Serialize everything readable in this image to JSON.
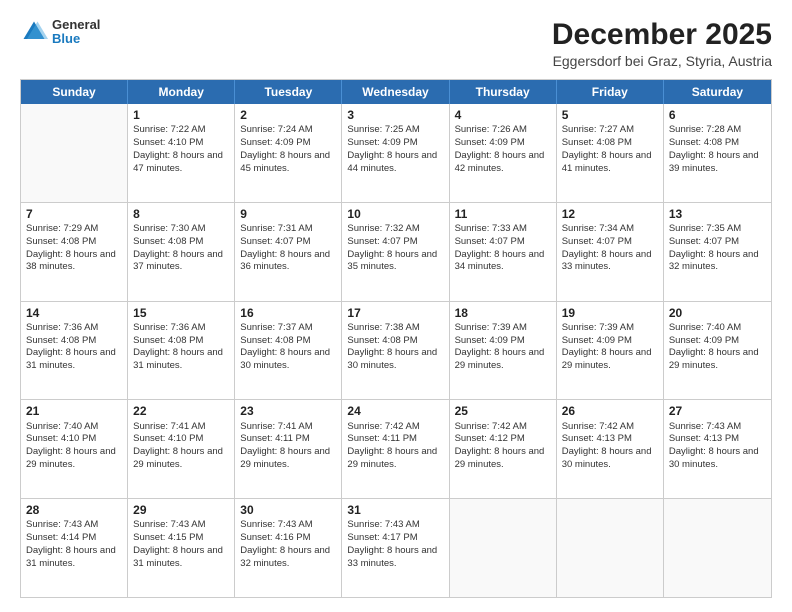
{
  "logo": {
    "general": "General",
    "blue": "Blue"
  },
  "header": {
    "title": "December 2025",
    "subtitle": "Eggersdorf bei Graz, Styria, Austria"
  },
  "weekdays": [
    "Sunday",
    "Monday",
    "Tuesday",
    "Wednesday",
    "Thursday",
    "Friday",
    "Saturday"
  ],
  "weeks": [
    [
      {
        "day": "",
        "sunrise": "",
        "sunset": "",
        "daylight": ""
      },
      {
        "day": "1",
        "sunrise": "Sunrise: 7:22 AM",
        "sunset": "Sunset: 4:10 PM",
        "daylight": "Daylight: 8 hours and 47 minutes."
      },
      {
        "day": "2",
        "sunrise": "Sunrise: 7:24 AM",
        "sunset": "Sunset: 4:09 PM",
        "daylight": "Daylight: 8 hours and 45 minutes."
      },
      {
        "day": "3",
        "sunrise": "Sunrise: 7:25 AM",
        "sunset": "Sunset: 4:09 PM",
        "daylight": "Daylight: 8 hours and 44 minutes."
      },
      {
        "day": "4",
        "sunrise": "Sunrise: 7:26 AM",
        "sunset": "Sunset: 4:09 PM",
        "daylight": "Daylight: 8 hours and 42 minutes."
      },
      {
        "day": "5",
        "sunrise": "Sunrise: 7:27 AM",
        "sunset": "Sunset: 4:08 PM",
        "daylight": "Daylight: 8 hours and 41 minutes."
      },
      {
        "day": "6",
        "sunrise": "Sunrise: 7:28 AM",
        "sunset": "Sunset: 4:08 PM",
        "daylight": "Daylight: 8 hours and 39 minutes."
      }
    ],
    [
      {
        "day": "7",
        "sunrise": "Sunrise: 7:29 AM",
        "sunset": "Sunset: 4:08 PM",
        "daylight": "Daylight: 8 hours and 38 minutes."
      },
      {
        "day": "8",
        "sunrise": "Sunrise: 7:30 AM",
        "sunset": "Sunset: 4:08 PM",
        "daylight": "Daylight: 8 hours and 37 minutes."
      },
      {
        "day": "9",
        "sunrise": "Sunrise: 7:31 AM",
        "sunset": "Sunset: 4:07 PM",
        "daylight": "Daylight: 8 hours and 36 minutes."
      },
      {
        "day": "10",
        "sunrise": "Sunrise: 7:32 AM",
        "sunset": "Sunset: 4:07 PM",
        "daylight": "Daylight: 8 hours and 35 minutes."
      },
      {
        "day": "11",
        "sunrise": "Sunrise: 7:33 AM",
        "sunset": "Sunset: 4:07 PM",
        "daylight": "Daylight: 8 hours and 34 minutes."
      },
      {
        "day": "12",
        "sunrise": "Sunrise: 7:34 AM",
        "sunset": "Sunset: 4:07 PM",
        "daylight": "Daylight: 8 hours and 33 minutes."
      },
      {
        "day": "13",
        "sunrise": "Sunrise: 7:35 AM",
        "sunset": "Sunset: 4:07 PM",
        "daylight": "Daylight: 8 hours and 32 minutes."
      }
    ],
    [
      {
        "day": "14",
        "sunrise": "Sunrise: 7:36 AM",
        "sunset": "Sunset: 4:08 PM",
        "daylight": "Daylight: 8 hours and 31 minutes."
      },
      {
        "day": "15",
        "sunrise": "Sunrise: 7:36 AM",
        "sunset": "Sunset: 4:08 PM",
        "daylight": "Daylight: 8 hours and 31 minutes."
      },
      {
        "day": "16",
        "sunrise": "Sunrise: 7:37 AM",
        "sunset": "Sunset: 4:08 PM",
        "daylight": "Daylight: 8 hours and 30 minutes."
      },
      {
        "day": "17",
        "sunrise": "Sunrise: 7:38 AM",
        "sunset": "Sunset: 4:08 PM",
        "daylight": "Daylight: 8 hours and 30 minutes."
      },
      {
        "day": "18",
        "sunrise": "Sunrise: 7:39 AM",
        "sunset": "Sunset: 4:09 PM",
        "daylight": "Daylight: 8 hours and 29 minutes."
      },
      {
        "day": "19",
        "sunrise": "Sunrise: 7:39 AM",
        "sunset": "Sunset: 4:09 PM",
        "daylight": "Daylight: 8 hours and 29 minutes."
      },
      {
        "day": "20",
        "sunrise": "Sunrise: 7:40 AM",
        "sunset": "Sunset: 4:09 PM",
        "daylight": "Daylight: 8 hours and 29 minutes."
      }
    ],
    [
      {
        "day": "21",
        "sunrise": "Sunrise: 7:40 AM",
        "sunset": "Sunset: 4:10 PM",
        "daylight": "Daylight: 8 hours and 29 minutes."
      },
      {
        "day": "22",
        "sunrise": "Sunrise: 7:41 AM",
        "sunset": "Sunset: 4:10 PM",
        "daylight": "Daylight: 8 hours and 29 minutes."
      },
      {
        "day": "23",
        "sunrise": "Sunrise: 7:41 AM",
        "sunset": "Sunset: 4:11 PM",
        "daylight": "Daylight: 8 hours and 29 minutes."
      },
      {
        "day": "24",
        "sunrise": "Sunrise: 7:42 AM",
        "sunset": "Sunset: 4:11 PM",
        "daylight": "Daylight: 8 hours and 29 minutes."
      },
      {
        "day": "25",
        "sunrise": "Sunrise: 7:42 AM",
        "sunset": "Sunset: 4:12 PM",
        "daylight": "Daylight: 8 hours and 29 minutes."
      },
      {
        "day": "26",
        "sunrise": "Sunrise: 7:42 AM",
        "sunset": "Sunset: 4:13 PM",
        "daylight": "Daylight: 8 hours and 30 minutes."
      },
      {
        "day": "27",
        "sunrise": "Sunrise: 7:43 AM",
        "sunset": "Sunset: 4:13 PM",
        "daylight": "Daylight: 8 hours and 30 minutes."
      }
    ],
    [
      {
        "day": "28",
        "sunrise": "Sunrise: 7:43 AM",
        "sunset": "Sunset: 4:14 PM",
        "daylight": "Daylight: 8 hours and 31 minutes."
      },
      {
        "day": "29",
        "sunrise": "Sunrise: 7:43 AM",
        "sunset": "Sunset: 4:15 PM",
        "daylight": "Daylight: 8 hours and 31 minutes."
      },
      {
        "day": "30",
        "sunrise": "Sunrise: 7:43 AM",
        "sunset": "Sunset: 4:16 PM",
        "daylight": "Daylight: 8 hours and 32 minutes."
      },
      {
        "day": "31",
        "sunrise": "Sunrise: 7:43 AM",
        "sunset": "Sunset: 4:17 PM",
        "daylight": "Daylight: 8 hours and 33 minutes."
      },
      {
        "day": "",
        "sunrise": "",
        "sunset": "",
        "daylight": ""
      },
      {
        "day": "",
        "sunrise": "",
        "sunset": "",
        "daylight": ""
      },
      {
        "day": "",
        "sunrise": "",
        "sunset": "",
        "daylight": ""
      }
    ]
  ]
}
